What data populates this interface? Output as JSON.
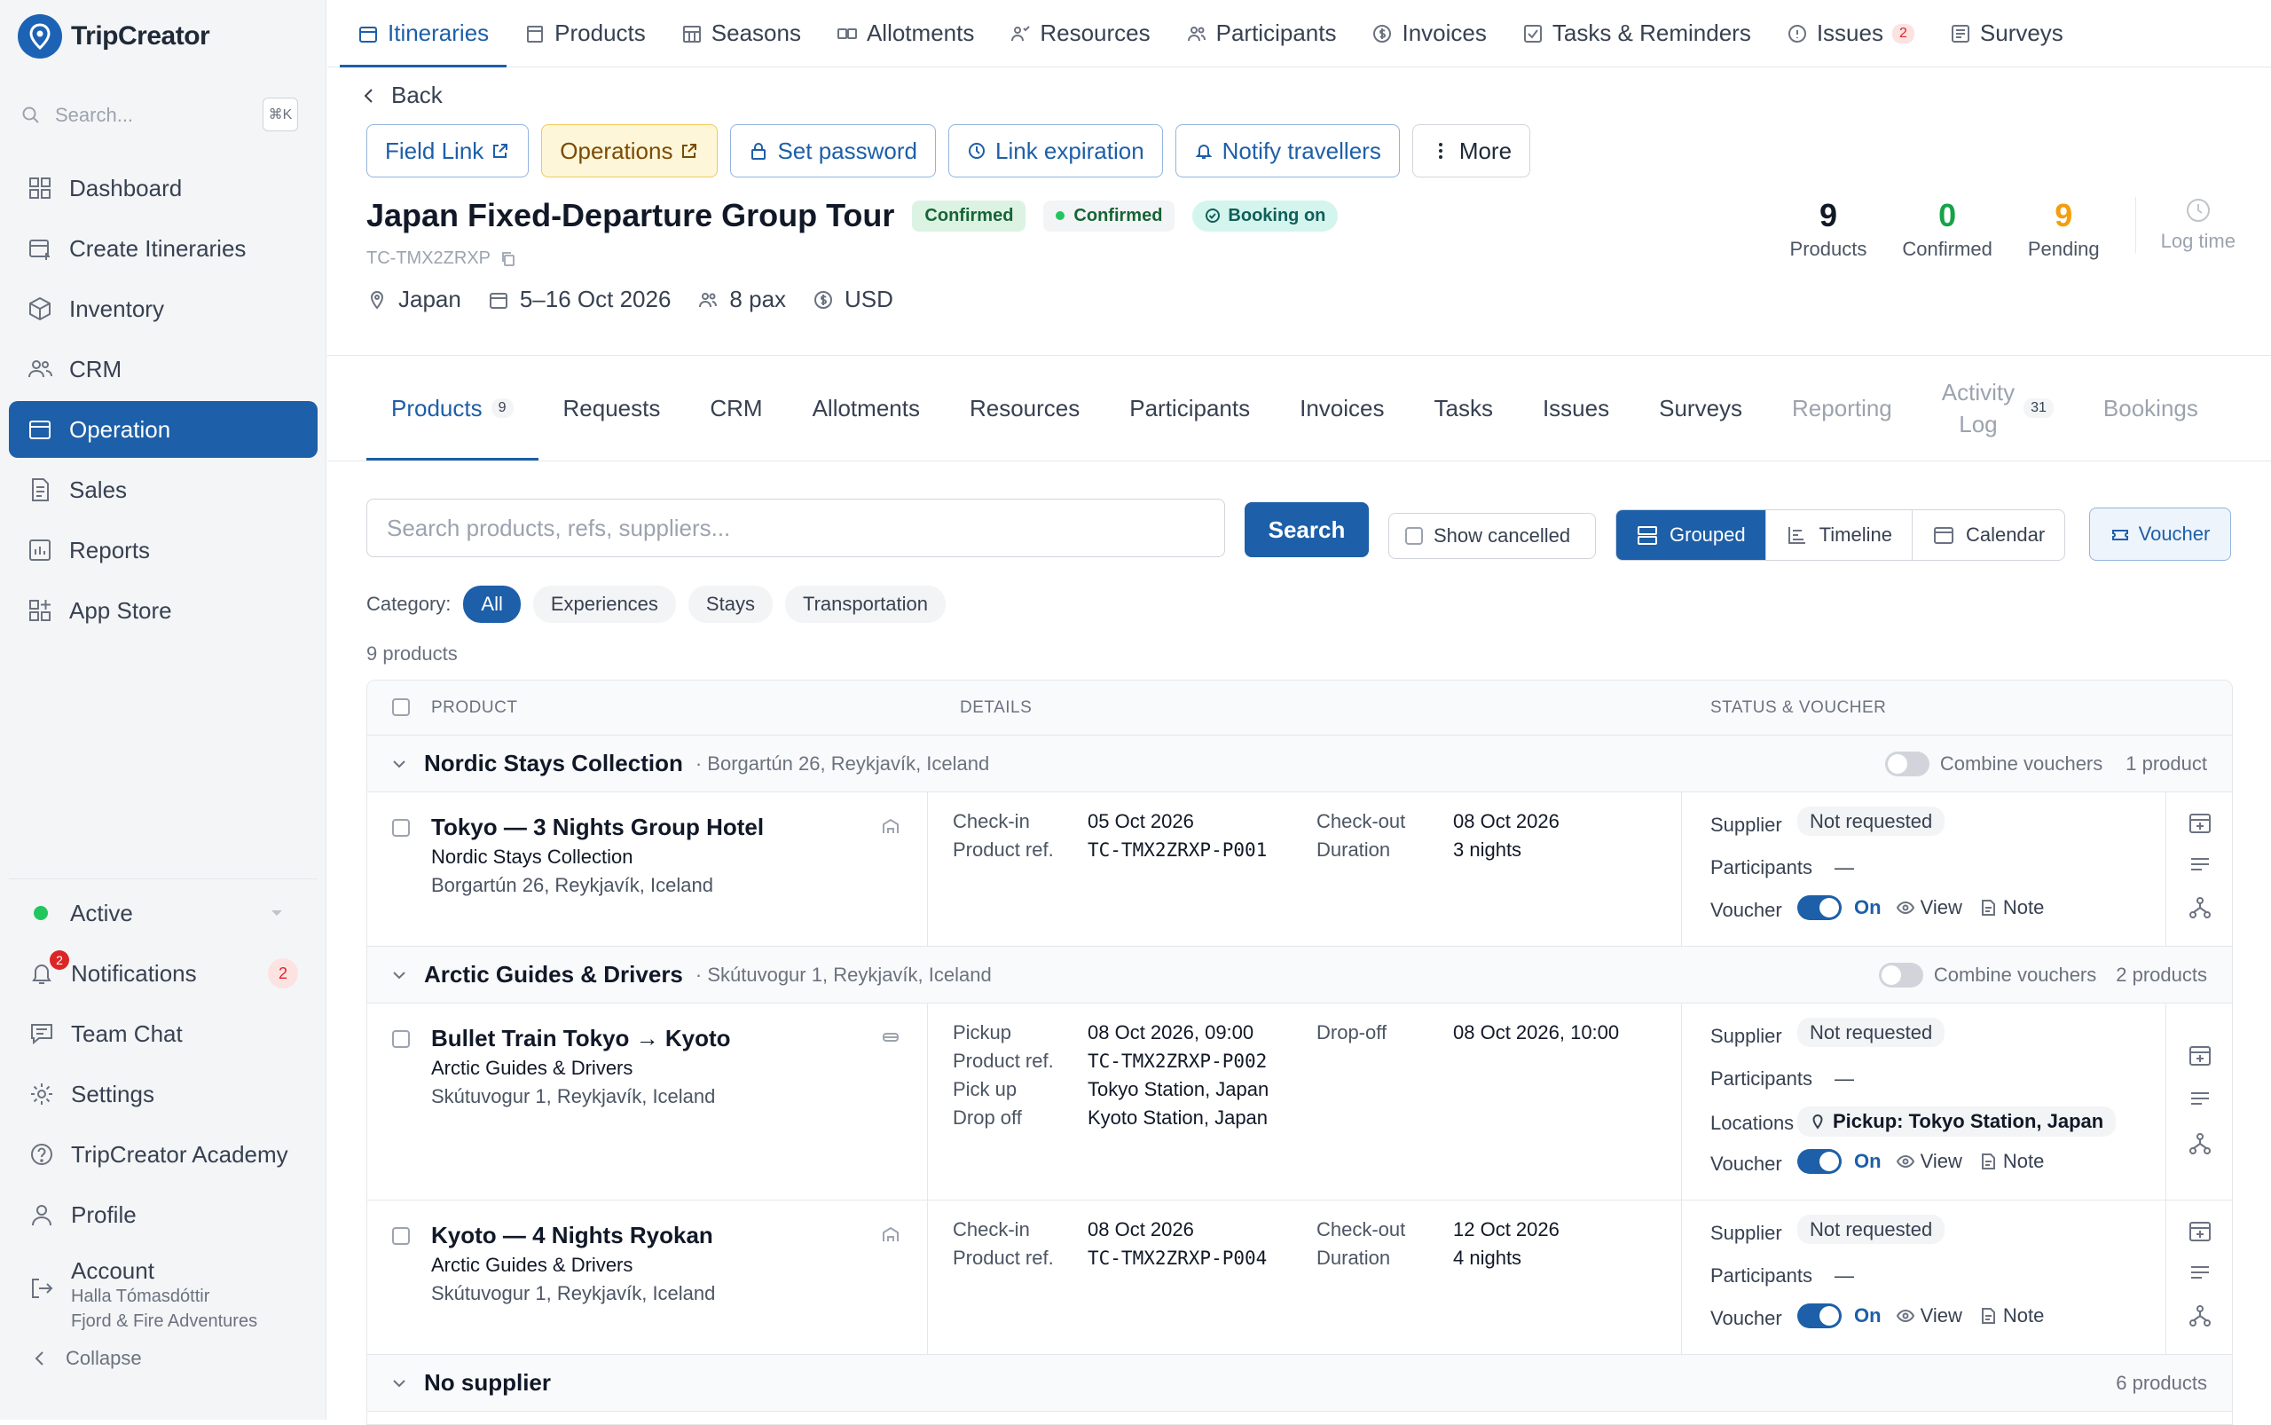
{
  "brand": {
    "name": "TripCreator"
  },
  "search": {
    "placeholder": "Search...",
    "shortcut": "⌘K"
  },
  "sidebar": {
    "items": [
      {
        "label": "Dashboard",
        "icon": "grid-icon"
      },
      {
        "label": "Create Itineraries",
        "icon": "calendar-plus-icon"
      },
      {
        "label": "Inventory",
        "icon": "box-icon"
      },
      {
        "label": "CRM",
        "icon": "users-icon"
      },
      {
        "label": "Operation",
        "icon": "calendar-icon"
      },
      {
        "label": "Sales",
        "icon": "document-icon"
      },
      {
        "label": "Reports",
        "icon": "chart-icon"
      },
      {
        "label": "App Store",
        "icon": "apps-icon"
      }
    ],
    "active": "Operation",
    "status": "Active",
    "notifications": {
      "label": "Notifications",
      "count": "2"
    },
    "team_chat": "Team Chat",
    "settings": "Settings",
    "academy": "TripCreator Academy",
    "profile": "Profile",
    "account": {
      "label": "Account",
      "name": "Halla Tómasdóttir",
      "company": "Fjord & Fire Adventures"
    },
    "collapse": "Collapse"
  },
  "topnav": {
    "items": [
      {
        "label": "Itineraries"
      },
      {
        "label": "Products"
      },
      {
        "label": "Seasons"
      },
      {
        "label": "Allotments"
      },
      {
        "label": "Resources"
      },
      {
        "label": "Participants"
      },
      {
        "label": "Invoices"
      },
      {
        "label": "Tasks & Reminders"
      },
      {
        "label": "Issues",
        "count": "2"
      },
      {
        "label": "Surveys"
      }
    ]
  },
  "back_label": "Back",
  "actions": {
    "field_link": "Field Link",
    "operations": "Operations",
    "set_password": "Set password",
    "link_expiration": "Link expiration",
    "notify": "Notify travellers",
    "more": "More"
  },
  "trip": {
    "title": "Japan Fixed-Departure Group Tour",
    "status1": "Confirmed",
    "status2": "Confirmed",
    "status3": "Booking on",
    "ref": "TC-TMX2ZRXP",
    "location": "Japan",
    "dates": "5–16 Oct 2026",
    "pax": "8 pax",
    "currency": "USD"
  },
  "stats": {
    "products": {
      "value": "9",
      "label": "Products",
      "color": "#111827"
    },
    "confirmed": {
      "value": "0",
      "label": "Confirmed",
      "color": "#16a34a"
    },
    "pending": {
      "value": "9",
      "label": "Pending",
      "color": "#f59e0b"
    },
    "log_time": "Log time"
  },
  "tabs": {
    "products": "Products",
    "products_count": "9",
    "requests": "Requests",
    "crm": "CRM",
    "allotments": "Allotments",
    "resources": "Resources",
    "participants": "Participants",
    "invoices": "Invoices",
    "tasks": "Tasks",
    "issues": "Issues",
    "surveys": "Surveys",
    "reporting": "Reporting",
    "activity1": "Activity",
    "activity2": "Log",
    "activity_count": "31",
    "bookings": "Bookings"
  },
  "toolbar": {
    "search_placeholder": "Search products, refs, suppliers...",
    "search_button": "Search",
    "show_cancelled": "Show cancelled",
    "grouped": "Grouped",
    "timeline": "Timeline",
    "calendar": "Calendar",
    "voucher": "Voucher"
  },
  "category": {
    "label": "Category:",
    "all": "All",
    "experiences": "Experiences",
    "stays": "Stays",
    "transportation": "Transportation"
  },
  "product_count": "9 products",
  "table": {
    "headers": {
      "product": "PRODUCT",
      "details": "DETAILS",
      "status": "STATUS & VOUCHER"
    },
    "combine": "Combine vouchers",
    "groups": [
      {
        "name": "Nordic Stays Collection",
        "address": "· Borgartún 26, Reykjavík, Iceland",
        "count": "1 product"
      },
      {
        "name": "Arctic Guides & Drivers",
        "address": "· Skútuvogur 1, Reykjavík, Iceland",
        "count": "2 products"
      },
      {
        "name": "No supplier",
        "count": "6 products"
      }
    ],
    "rows": [
      {
        "name": "Tokyo — 3 Nights Group Hotel",
        "supplier": "Nordic Stays Collection",
        "address": "Borgartún 26, Reykjavík, Iceland",
        "l1": "Check-in",
        "v1": "05 Oct 2026",
        "l2": "Product ref.",
        "v2": "TC-TMX2ZRXP-P001",
        "l3": "Check-out",
        "v3": "08 Oct 2026",
        "l4": "Duration",
        "v4": "3 nights"
      },
      {
        "name": "Bullet Train Tokyo → Kyoto",
        "supplier": "Arctic Guides & Drivers",
        "address": "Skútuvogur 1, Reykjavík, Iceland",
        "l1": "Pickup",
        "v1": "08 Oct 2026, 09:00",
        "l2": "Product ref.",
        "v2": "TC-TMX2ZRXP-P002",
        "l5": "Pick up",
        "v5": "Tokyo Station, Japan",
        "l6": "Drop off",
        "v6": "Kyoto Station, Japan",
        "l3": "Drop-off",
        "v3": "08 Oct 2026, 10:00",
        "location_label": "Locations",
        "location": "Pickup: Tokyo Station, Japan"
      },
      {
        "name": "Kyoto — 4 Nights Ryokan",
        "supplier": "Arctic Guides & Drivers",
        "address": "Skútuvogur 1, Reykjavík, Iceland",
        "l1": "Check-in",
        "v1": "08 Oct 2026",
        "l2": "Product ref.",
        "v2": "TC-TMX2ZRXP-P004",
        "l3": "Check-out",
        "v3": "12 Oct 2026",
        "l4": "Duration",
        "v4": "4 nights"
      }
    ],
    "status": {
      "supplier": "Supplier",
      "not_requested": "Not requested",
      "participants": "Participants",
      "dash": "—",
      "voucher": "Voucher",
      "on": "On",
      "view": "View",
      "note": "Note"
    }
  }
}
